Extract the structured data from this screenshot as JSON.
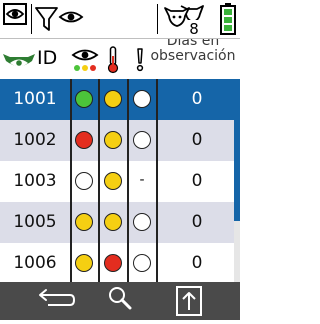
{
  "colors": {
    "selected_row": "#1565a8",
    "alt_row": "#dcdde8",
    "white_row": "#ffffff",
    "bottom_bar": "#4a4a4a",
    "dot_green": "#4cc43a",
    "dot_red": "#e32d1f",
    "dot_yellow": "#f5cf12",
    "dot_empty": "#ffffff"
  },
  "topbar": {
    "icons": [
      "eye-box-icon",
      "filter-eye-icon",
      "cow-heads-icon",
      "battery-icon"
    ],
    "cow_count": "8"
  },
  "header": {
    "id_label": "ID",
    "days_label": "Días en\nobservación"
  },
  "rows": [
    {
      "id": "1001",
      "c1": "green",
      "c2": "yellow",
      "c3": "empty",
      "days": "0",
      "selected": true
    },
    {
      "id": "1002",
      "c1": "red",
      "c2": "yellow",
      "c3": "empty",
      "days": "0",
      "selected": false
    },
    {
      "id": "1003",
      "c1": "empty",
      "c2": "yellow",
      "c3": "-",
      "days": "0",
      "selected": false
    },
    {
      "id": "1005",
      "c1": "yellow",
      "c2": "yellow",
      "c3": "empty",
      "days": "0",
      "selected": false
    },
    {
      "id": "1006",
      "c1": "yellow",
      "c2": "red",
      "c3": "empty",
      "days": "0",
      "selected": false
    }
  ],
  "scroll": {
    "visible_fraction": 0.7
  },
  "bottombar": {
    "buttons": [
      "back-arrow-icon",
      "search-icon",
      "export-up-icon"
    ]
  }
}
